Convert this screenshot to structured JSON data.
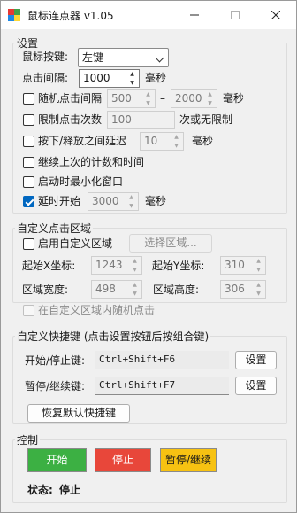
{
  "window": {
    "title": "鼠标连点器 v1.05"
  },
  "settings": {
    "group_label": "设置",
    "mouse_button_label": "鼠标按键:",
    "mouse_button_value": "左键",
    "interval_label": "点击间隔:",
    "interval_value": "1000",
    "interval_unit": "毫秒",
    "random_interval": {
      "label": "随机点击间隔",
      "checked": false,
      "min": "500",
      "dash": "–",
      "max": "2000",
      "unit": "毫秒"
    },
    "limit_count": {
      "label": "限制点击次数",
      "checked": false,
      "value": "100",
      "suffix": "次或无限制"
    },
    "press_delay": {
      "label": "按下/释放之间延迟",
      "checked": false,
      "value": "10",
      "unit": "毫秒"
    },
    "continue_count": {
      "label": "继续上次的计数和时间",
      "checked": false
    },
    "minimize_on_start": {
      "label": "启动时最小化窗口",
      "checked": false
    },
    "delay_start": {
      "label": "延时开始",
      "checked": true,
      "value": "3000",
      "unit": "毫秒"
    }
  },
  "custom_area": {
    "group_label": "自定义点击区域",
    "enable_label": "启用自定义区域",
    "enable_checked": false,
    "select_button": "选择区域...",
    "start_x_label": "起始X坐标:",
    "start_x_value": "1243",
    "start_y_label": "起始Y坐标:",
    "start_y_value": "310",
    "width_label": "区域宽度:",
    "width_value": "498",
    "height_label": "区域高度:",
    "height_value": "306",
    "random_in_area_label": "在自定义区域内随机点击",
    "random_in_area_checked": false
  },
  "hotkeys": {
    "group_label": "自定义快捷键 (点击设置按钮后按组合键)",
    "start_stop_label": "开始/停止键:",
    "start_stop_value": "Ctrl+Shift+F6",
    "start_stop_button": "设置",
    "pause_resume_label": "暂停/继续键:",
    "pause_resume_value": "Ctrl+Shift+F7",
    "pause_resume_button": "设置",
    "restore_button": "恢复默认快捷键"
  },
  "control": {
    "group_label": "控制",
    "start_button": "开始",
    "stop_button": "停止",
    "pause_button": "暂停/继续",
    "start_color": "#3cb043",
    "stop_color": "#e8473a",
    "pause_color": "#f7c212",
    "status_label": "状态:",
    "status_value": "停止"
  }
}
